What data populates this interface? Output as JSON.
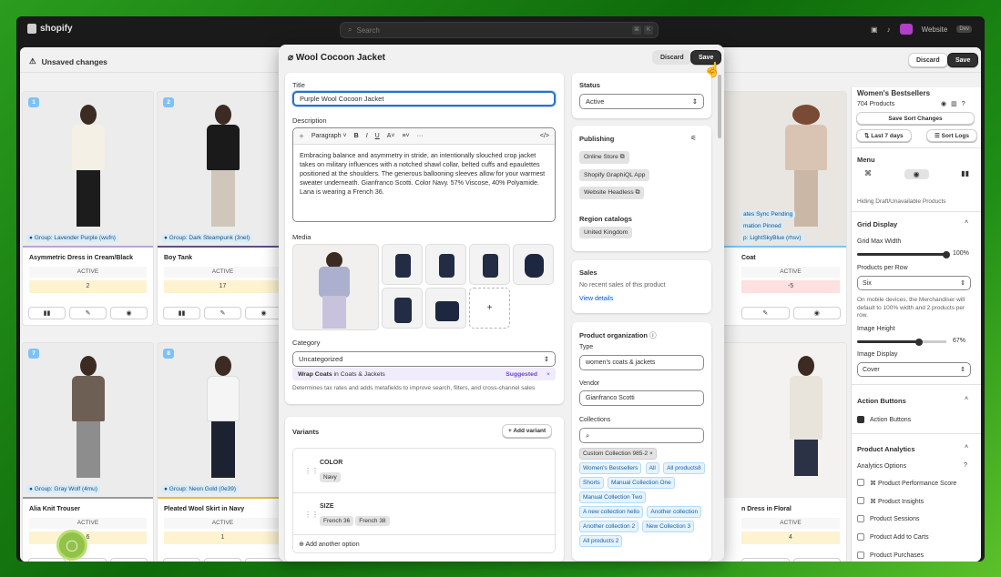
{
  "app": {
    "brand": "shopify",
    "search_placeholder": "Search",
    "kbd1": "⌘",
    "kbd2": "K",
    "store_name": "Website",
    "store_badge": "Dev"
  },
  "unsaved": {
    "text": "Unsaved changes",
    "discard": "Discard",
    "save": "Save"
  },
  "products": [
    {
      "num": "1",
      "group": "Group: Lavender Purple (wufn)",
      "name": "Asymmetric Dress in Cream/Black",
      "status": "ACTIVE",
      "count": "2",
      "bar": "#b9a3e0"
    },
    {
      "num": "2",
      "group": "Group: Dark Steampunk (3nel)",
      "name": "Boy Tank",
      "status": "ACTIVE",
      "count": "17",
      "bar": "#5f4b8b"
    },
    {
      "num": "7",
      "group": "Group: Gray Wolf (4mu)",
      "name": "Alia Knit Trouser",
      "status": "ACTIVE",
      "count": "6",
      "bar": "#9a9a9a"
    },
    {
      "num": "8",
      "group": "Group: Neon Gold (0e39)",
      "name": "Pleated Wool Skirt in Navy",
      "status": "ACTIVE",
      "count": "1",
      "bar": "#e0c13a"
    }
  ],
  "right_cards": [
    {
      "group1": "ates Sync Pending",
      "group2": "mation Pinned",
      "group3": "p: LightSkyBlue (rhsv)",
      "name": "Coat",
      "status": "ACTIVE",
      "count": "-5"
    },
    {
      "name": "n Dress in Floral",
      "status": "ACTIVE",
      "count": "4"
    }
  ],
  "modal": {
    "title": "Wool Cocoon Jacket",
    "discard": "Discard",
    "save": "Save",
    "title_label": "Title",
    "title_value": "Purple Wool Cocoon Jacket",
    "desc_label": "Description",
    "paragraph": "Paragraph",
    "description": "Embracing balance and asymmetry in stride, an intentionally slouched crop jacket takes on military influences with a notched shawl collar, belted cuffs and epaulettes positioned at the shoulders. The generous ballooning sleeves allow for your warmest sweater underneath. Gianfranco Scotti. Color Navy. 57% Viscose, 40% Polyamide. Lana is wearing a French 36.",
    "media_label": "Media",
    "add_media": "+",
    "category_label": "Category",
    "category_value": "Uncategorized",
    "suggested_cat": "Wrap Coats",
    "suggested_in": "in Coats & Jackets",
    "suggested": "Suggested",
    "category_help": "Determines tax rates and adds metafields to improve search, filters, and cross-channel sales",
    "variants_label": "Variants",
    "add_variant": "+ Add variant",
    "color_label": "COLOR",
    "color_values": [
      "Navy"
    ],
    "size_label": "SIZE",
    "size_values": [
      "French 36",
      "French 38"
    ],
    "add_option": "Add another option",
    "status_label": "Status",
    "status_value": "Active",
    "publishing_label": "Publishing",
    "channels": [
      "Online Store",
      "Shopify GraphiQL App",
      "Website Headless"
    ],
    "region_label": "Region catalogs",
    "region_value": "United Kingdom",
    "sales_label": "Sales",
    "sales_text": "No recent sales of this product",
    "view_details": "View details",
    "org_label": "Product organization",
    "type_label": "Type",
    "type_value": "women's coats & jackets",
    "vendor_label": "Vendor",
    "vendor_value": "Gianfranco Scotti",
    "collections_label": "Collections",
    "collections": [
      "Custom Collection 985-2 ×",
      "Women's Bestsellers",
      "All",
      "All products8",
      "Shorts",
      "Manual Collection One",
      "Manual Collection Two",
      "A new collection hello",
      "Another collection",
      "Another collection 2",
      "New Collection 3",
      "All products 2"
    ]
  },
  "side": {
    "title": "Women's Bestsellers",
    "count": "704 Products",
    "save_sort": "Save Sort Changes",
    "last7": "Last 7 days",
    "sort_logs": "Sort Logs",
    "menu": "Menu",
    "hiding": "Hiding Draft/Unavailable Products",
    "grid_display": "Grid Display",
    "grid_max": "Grid Max Width",
    "grid_max_val": "100%",
    "per_row": "Products per Row",
    "per_row_val": "Six",
    "mobile_note": "On mobile devices, the Merchandiser will default to 100% width and 2 products per row.",
    "img_height": "Image Height",
    "img_height_val": "67%",
    "img_display": "Image Display",
    "img_display_val": "Cover",
    "action_buttons": "Action Buttons",
    "action_buttons_chk": "Action Buttons",
    "analytics": "Product Analytics",
    "analytics_opts": "Analytics Options",
    "analytics_items": [
      "Product Performance Score",
      "Product Insights",
      "Product Sessions",
      "Product Add to Carts",
      "Product Purchases"
    ]
  }
}
